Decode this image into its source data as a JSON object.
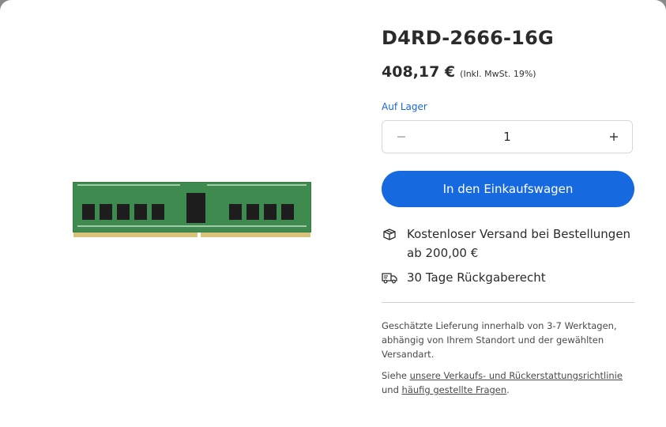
{
  "product": {
    "title": "D4RD-2666-16G",
    "price": "408,17 €",
    "tax_note": "(Inkl. MwSt. 19%)",
    "stock_status": "Auf Lager",
    "image_icon": "ram-module-image"
  },
  "quantity": {
    "value": "1",
    "minus_icon": "minus-icon",
    "plus_icon": "plus-icon"
  },
  "cart_button": {
    "label": "In den Einkaufswagen",
    "color": "#1769e0"
  },
  "features": [
    {
      "icon": "shipping-box-icon",
      "line1": "Kostenloser Versand bei Bestellungen",
      "line2": "ab 200,00 €"
    },
    {
      "icon": "delivery-truck-icon",
      "line1": "30 Tage Rückgaberecht"
    }
  ],
  "delivery": {
    "line1": "Geschätzte Lieferung innerhalb von 3-7 Werktagen,",
    "line2": "abhängig von Ihrem Standort und der gewählten",
    "line3": "Versandart."
  },
  "policy": {
    "prefix": "Siehe",
    "link1": "unsere Verkaufs- und Rückerstattungsrichtlinie",
    "middle": "und",
    "link2": "häufig gestellte Fragen",
    "suffix": "."
  }
}
